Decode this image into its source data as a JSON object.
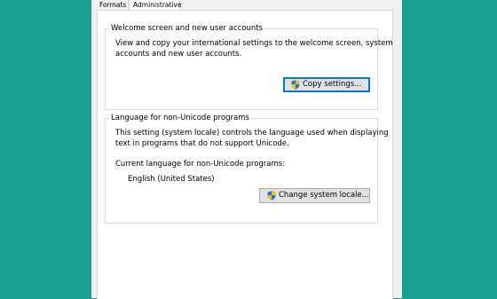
{
  "tabs": [
    {
      "label": "Formats"
    },
    {
      "label": "Administrative"
    }
  ],
  "welcome_group": {
    "title": "Welcome screen and new user accounts",
    "desc_line1": "View and copy your international settings to the welcome screen, system",
    "desc_line2": "accounts and new user accounts.",
    "button_label": "Copy settings..."
  },
  "unicode_group": {
    "title": "Language for non-Unicode programs",
    "desc_line1": "This setting (system locale) controls the language used when displaying",
    "desc_line2": "text in programs that do not support Unicode.",
    "current_label": "Current language for non-Unicode programs:",
    "current_value": "English (United States)",
    "button_label": "Change system locale..."
  },
  "colors": {
    "desktop": "#1a9f8f",
    "focus_border": "#0078d7",
    "shield_blue": "#2a6fd6",
    "shield_yellow": "#f5c200"
  },
  "icons": {
    "uac": "uac-shield-icon"
  }
}
